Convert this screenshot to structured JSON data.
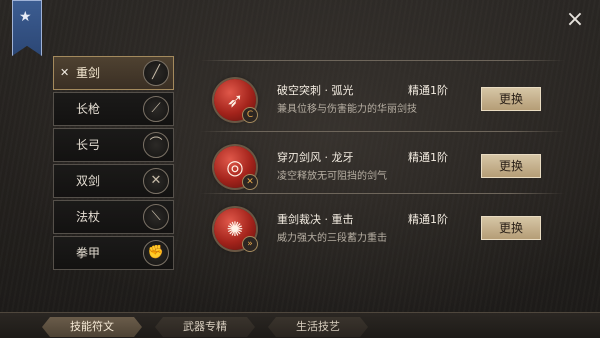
{
  "header": {
    "banner_icon": "★",
    "close_label": "×"
  },
  "sidebar": {
    "items": [
      {
        "label": "重剑",
        "icon": "╱",
        "icon_name": "greatsword-icon",
        "active": true,
        "mark": "✕"
      },
      {
        "label": "长枪",
        "icon": "⟋",
        "icon_name": "spear-icon"
      },
      {
        "label": "长弓",
        "icon": "⌒",
        "icon_name": "bow-icon"
      },
      {
        "label": "双剑",
        "icon": "✕",
        "icon_name": "dual-blades-icon"
      },
      {
        "label": "法杖",
        "icon": "⟍",
        "icon_name": "staff-icon"
      },
      {
        "label": "拳甲",
        "icon": "✊",
        "icon_name": "gauntlet-icon"
      }
    ]
  },
  "skills": [
    {
      "name": "破空突刺 · 弧光",
      "level": "精通1阶",
      "desc": "兼具位移与伤害能力的华丽剑技",
      "icon": "➶",
      "badge": "C",
      "button": "更换"
    },
    {
      "name": "穿刃剑风 · 龙牙",
      "level": "精通1阶",
      "desc": "凌空释放无可阻挡的剑气",
      "icon": "◎",
      "badge": "✕",
      "button": "更换"
    },
    {
      "name": "重剑裁决 · 重击",
      "level": "精通1阶",
      "desc": "威力强大的三段蓄力重击",
      "icon": "✺",
      "badge": "»",
      "button": "更换"
    }
  ],
  "bottom_tabs": [
    {
      "label": "技能符文",
      "active": true
    },
    {
      "label": "武器专精"
    },
    {
      "label": "生活技艺"
    }
  ],
  "colors": {
    "accent": "#b59d76",
    "active_tab": "#5a4d3e",
    "orb_red": "#a3231b"
  }
}
